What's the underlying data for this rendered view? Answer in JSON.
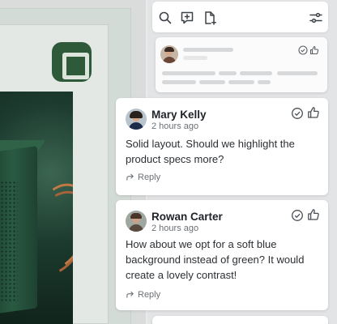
{
  "toolbar": {
    "icons": [
      "search-icon",
      "add-comment-icon",
      "add-file-icon",
      "filter-settings-icon"
    ]
  },
  "comments": [
    {
      "author": "Mary Kelly",
      "time": "2 hours ago",
      "text": "Solid layout. Should we highlight the product specs more?",
      "reply_label": "Reply"
    },
    {
      "author": "Rowan Carter",
      "time": "2 hours ago",
      "text": "How about we opt for a soft blue background instead of green? It would create a lovely contrast!",
      "reply_label": "Reply"
    }
  ],
  "colors": {
    "brand_green": "#2e5a3a",
    "panel_bg": "#e3e4e5",
    "card_bg": "#ffffff",
    "muted_text": "#6b7177"
  }
}
